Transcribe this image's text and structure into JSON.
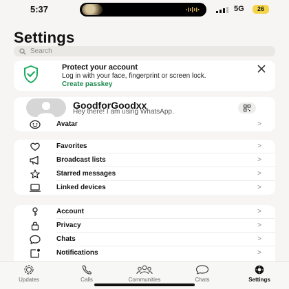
{
  "status_bar": {
    "time": "5:37",
    "network": "5G",
    "battery": "26"
  },
  "page": {
    "title": "Settings"
  },
  "search": {
    "placeholder": "Search"
  },
  "protect": {
    "title": "Protect your account",
    "description": "Log in with your face, fingerprint or screen lock.",
    "link": "Create passkey",
    "accent": "#1d8b4f"
  },
  "profile": {
    "name": "GoodforGoodxx",
    "status": "Hey there! I am using WhatsApp.",
    "avatar_row_label": "Avatar"
  },
  "chevron": ">",
  "list1": [
    {
      "label": "Favorites",
      "icon": "heart-icon"
    },
    {
      "label": "Broadcast lists",
      "icon": "megaphone-icon"
    },
    {
      "label": "Starred messages",
      "icon": "star-icon"
    },
    {
      "label": "Linked devices",
      "icon": "laptop-icon"
    }
  ],
  "list2": [
    {
      "label": "Account",
      "icon": "key-icon"
    },
    {
      "label": "Privacy",
      "icon": "lock-icon"
    },
    {
      "label": "Chats",
      "icon": "chat-bubble-icon"
    },
    {
      "label": "Notifications",
      "icon": "notification-icon"
    }
  ],
  "tabs": [
    {
      "label": "Updates",
      "icon": "updates-icon",
      "active": false
    },
    {
      "label": "Calls",
      "icon": "phone-icon",
      "active": false
    },
    {
      "label": "Communities",
      "icon": "communities-icon",
      "active": false
    },
    {
      "label": "Chats",
      "icon": "chats-icon",
      "active": false
    },
    {
      "label": "Settings",
      "icon": "settings-gear-icon",
      "active": true
    }
  ]
}
